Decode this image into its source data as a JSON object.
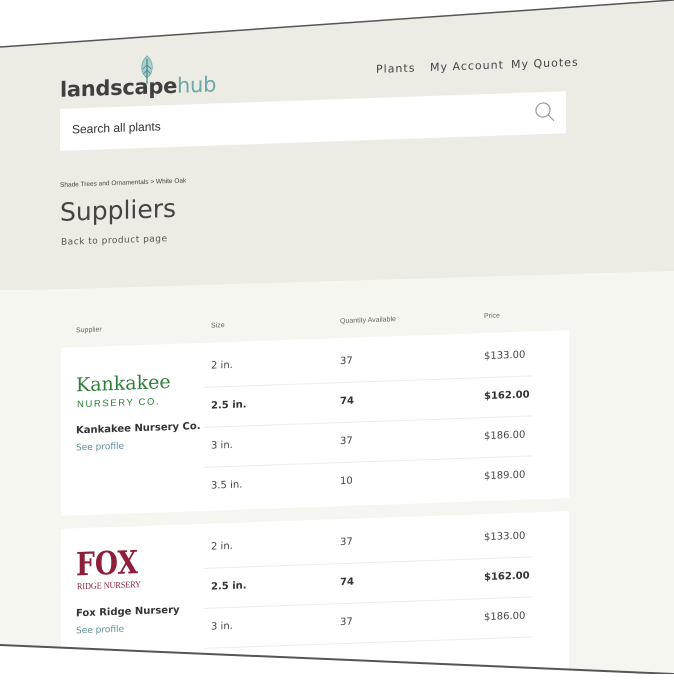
{
  "brand": {
    "part1": "landscape",
    "part2": "hub"
  },
  "nav": {
    "plants": "Plants",
    "account": "My Account",
    "quotes": "My Quotes"
  },
  "search": {
    "placeholder": "Search all plants"
  },
  "breadcrumb": "Shade Trees and Ornamentals > White Oak",
  "page_title": "Suppliers",
  "back_link": "Back to product page",
  "columns": {
    "supplier": "Supplier",
    "size": "Size",
    "quantity": "Quantity Available",
    "price": "Price"
  },
  "suppliers": [
    {
      "name": "Kankakee Nursery Co.",
      "logo_text": [
        "Kankakee",
        "NURSERY CO."
      ],
      "profile_link": "See profile",
      "rows": [
        {
          "size": "2 in.",
          "qty": "37",
          "price": "$133.00",
          "emphasis": false
        },
        {
          "size": "2.5 in.",
          "qty": "74",
          "price": "$162.00",
          "emphasis": true
        },
        {
          "size": "3 in.",
          "qty": "37",
          "price": "$186.00",
          "emphasis": false
        },
        {
          "size": "3.5 in.",
          "qty": "10",
          "price": "$189.00",
          "emphasis": false
        }
      ]
    },
    {
      "name": "Fox Ridge Nursery",
      "logo_text": [
        "FOX",
        "RIDGE NURSERY"
      ],
      "profile_link": "See profile",
      "rows": [
        {
          "size": "2 in.",
          "qty": "37",
          "price": "$133.00",
          "emphasis": false
        },
        {
          "size": "2.5 in.",
          "qty": "74",
          "price": "$162.00",
          "emphasis": true
        },
        {
          "size": "3 in.",
          "qty": "37",
          "price": "$186.00",
          "emphasis": false
        }
      ]
    }
  ],
  "colors": {
    "header_bg": "#ecebe4",
    "page_bg": "#f6f6f1",
    "brand_accent": "#6fa7a9",
    "kankakee_green": "#2f7d3a",
    "fox_maroon": "#8e1f3a",
    "link": "#5a8f9a"
  },
  "icons": {
    "search": "search-icon",
    "logo_tree": "tree-icon"
  }
}
